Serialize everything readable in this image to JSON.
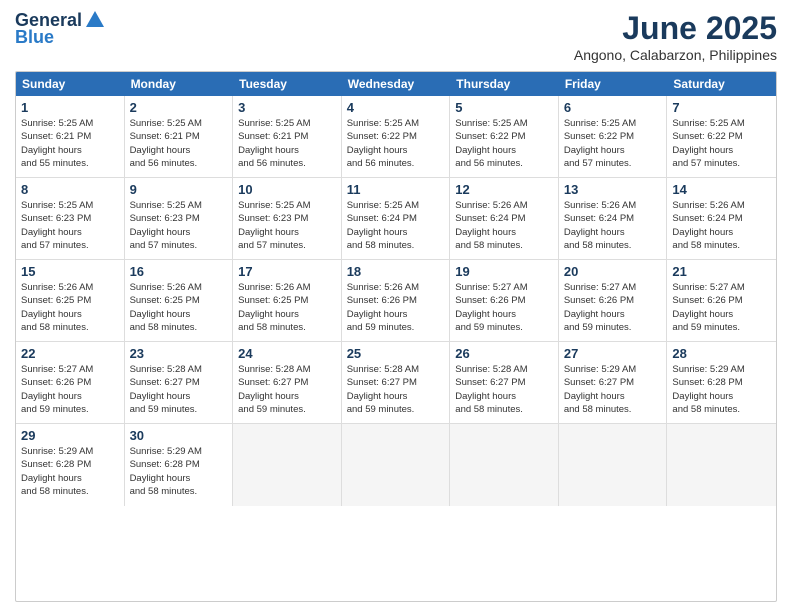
{
  "header": {
    "logo": {
      "general": "General",
      "blue": "Blue"
    },
    "title": "June 2025",
    "subtitle": "Angono, Calabarzon, Philippines"
  },
  "calendar": {
    "days_of_week": [
      "Sunday",
      "Monday",
      "Tuesday",
      "Wednesday",
      "Thursday",
      "Friday",
      "Saturday"
    ],
    "weeks": [
      [
        {
          "day": "",
          "empty": true
        },
        {
          "day": "2",
          "sunrise": "Sunrise: 5:25 AM",
          "sunset": "Sunset: 6:21 PM",
          "daylight": "Daylight: 12 hours",
          "minutes": "and 56 minutes."
        },
        {
          "day": "3",
          "sunrise": "Sunrise: 5:25 AM",
          "sunset": "Sunset: 6:21 PM",
          "daylight": "Daylight: 12 hours",
          "minutes": "and 56 minutes."
        },
        {
          "day": "4",
          "sunrise": "Sunrise: 5:25 AM",
          "sunset": "Sunset: 6:22 PM",
          "daylight": "Daylight: 12 hours",
          "minutes": "and 56 minutes."
        },
        {
          "day": "5",
          "sunrise": "Sunrise: 5:25 AM",
          "sunset": "Sunset: 6:22 PM",
          "daylight": "Daylight: 12 hours",
          "minutes": "and 56 minutes."
        },
        {
          "day": "6",
          "sunrise": "Sunrise: 5:25 AM",
          "sunset": "Sunset: 6:22 PM",
          "daylight": "Daylight: 12 hours",
          "minutes": "and 57 minutes."
        },
        {
          "day": "7",
          "sunrise": "Sunrise: 5:25 AM",
          "sunset": "Sunset: 6:22 PM",
          "daylight": "Daylight: 12 hours",
          "minutes": "and 57 minutes."
        }
      ],
      [
        {
          "day": "1",
          "sunrise": "Sunrise: 5:25 AM",
          "sunset": "Sunset: 6:21 PM",
          "daylight": "Daylight: 12 hours",
          "minutes": "and 55 minutes."
        },
        {
          "day": "9",
          "sunrise": "Sunrise: 5:25 AM",
          "sunset": "Sunset: 6:23 PM",
          "daylight": "Daylight: 12 hours",
          "minutes": "and 57 minutes."
        },
        {
          "day": "10",
          "sunrise": "Sunrise: 5:25 AM",
          "sunset": "Sunset: 6:23 PM",
          "daylight": "Daylight: 12 hours",
          "minutes": "and 57 minutes."
        },
        {
          "day": "11",
          "sunrise": "Sunrise: 5:25 AM",
          "sunset": "Sunset: 6:24 PM",
          "daylight": "Daylight: 12 hours",
          "minutes": "and 58 minutes."
        },
        {
          "day": "12",
          "sunrise": "Sunrise: 5:26 AM",
          "sunset": "Sunset: 6:24 PM",
          "daylight": "Daylight: 12 hours",
          "minutes": "and 58 minutes."
        },
        {
          "day": "13",
          "sunrise": "Sunrise: 5:26 AM",
          "sunset": "Sunset: 6:24 PM",
          "daylight": "Daylight: 12 hours",
          "minutes": "and 58 minutes."
        },
        {
          "day": "14",
          "sunrise": "Sunrise: 5:26 AM",
          "sunset": "Sunset: 6:24 PM",
          "daylight": "Daylight: 12 hours",
          "minutes": "and 58 minutes."
        }
      ],
      [
        {
          "day": "8",
          "sunrise": "Sunrise: 5:25 AM",
          "sunset": "Sunset: 6:23 PM",
          "daylight": "Daylight: 12 hours",
          "minutes": "and 57 minutes."
        },
        {
          "day": "16",
          "sunrise": "Sunrise: 5:26 AM",
          "sunset": "Sunset: 6:25 PM",
          "daylight": "Daylight: 12 hours",
          "minutes": "and 58 minutes."
        },
        {
          "day": "17",
          "sunrise": "Sunrise: 5:26 AM",
          "sunset": "Sunset: 6:25 PM",
          "daylight": "Daylight: 12 hours",
          "minutes": "and 58 minutes."
        },
        {
          "day": "18",
          "sunrise": "Sunrise: 5:26 AM",
          "sunset": "Sunset: 6:26 PM",
          "daylight": "Daylight: 12 hours",
          "minutes": "and 59 minutes."
        },
        {
          "day": "19",
          "sunrise": "Sunrise: 5:27 AM",
          "sunset": "Sunset: 6:26 PM",
          "daylight": "Daylight: 12 hours",
          "minutes": "and 59 minutes."
        },
        {
          "day": "20",
          "sunrise": "Sunrise: 5:27 AM",
          "sunset": "Sunset: 6:26 PM",
          "daylight": "Daylight: 12 hours",
          "minutes": "and 59 minutes."
        },
        {
          "day": "21",
          "sunrise": "Sunrise: 5:27 AM",
          "sunset": "Sunset: 6:26 PM",
          "daylight": "Daylight: 12 hours",
          "minutes": "and 59 minutes."
        }
      ],
      [
        {
          "day": "15",
          "sunrise": "Sunrise: 5:26 AM",
          "sunset": "Sunset: 6:25 PM",
          "daylight": "Daylight: 12 hours",
          "minutes": "and 58 minutes."
        },
        {
          "day": "23",
          "sunrise": "Sunrise: 5:28 AM",
          "sunset": "Sunset: 6:27 PM",
          "daylight": "Daylight: 12 hours",
          "minutes": "and 59 minutes."
        },
        {
          "day": "24",
          "sunrise": "Sunrise: 5:28 AM",
          "sunset": "Sunset: 6:27 PM",
          "daylight": "Daylight: 12 hours",
          "minutes": "and 59 minutes."
        },
        {
          "day": "25",
          "sunrise": "Sunrise: 5:28 AM",
          "sunset": "Sunset: 6:27 PM",
          "daylight": "Daylight: 12 hours",
          "minutes": "and 59 minutes."
        },
        {
          "day": "26",
          "sunrise": "Sunrise: 5:28 AM",
          "sunset": "Sunset: 6:27 PM",
          "daylight": "Daylight: 12 hours",
          "minutes": "and 58 minutes."
        },
        {
          "day": "27",
          "sunrise": "Sunrise: 5:29 AM",
          "sunset": "Sunset: 6:27 PM",
          "daylight": "Daylight: 12 hours",
          "minutes": "and 58 minutes."
        },
        {
          "day": "28",
          "sunrise": "Sunrise: 5:29 AM",
          "sunset": "Sunset: 6:28 PM",
          "daylight": "Daylight: 12 hours",
          "minutes": "and 58 minutes."
        }
      ],
      [
        {
          "day": "22",
          "sunrise": "Sunrise: 5:27 AM",
          "sunset": "Sunset: 6:26 PM",
          "daylight": "Daylight: 12 hours",
          "minutes": "and 59 minutes."
        },
        {
          "day": "30",
          "sunrise": "Sunrise: 5:29 AM",
          "sunset": "Sunset: 6:28 PM",
          "daylight": "Daylight: 12 hours",
          "minutes": "and 58 minutes."
        },
        {
          "day": "",
          "empty": true
        },
        {
          "day": "",
          "empty": true
        },
        {
          "day": "",
          "empty": true
        },
        {
          "day": "",
          "empty": true
        },
        {
          "day": "",
          "empty": true
        }
      ],
      [
        {
          "day": "29",
          "sunrise": "Sunrise: 5:29 AM",
          "sunset": "Sunset: 6:28 PM",
          "daylight": "Daylight: 12 hours",
          "minutes": "and 58 minutes."
        },
        {
          "day": "",
          "empty": true
        },
        {
          "day": "",
          "empty": true
        },
        {
          "day": "",
          "empty": true
        },
        {
          "day": "",
          "empty": true
        },
        {
          "day": "",
          "empty": true
        },
        {
          "day": "",
          "empty": true
        }
      ]
    ]
  }
}
